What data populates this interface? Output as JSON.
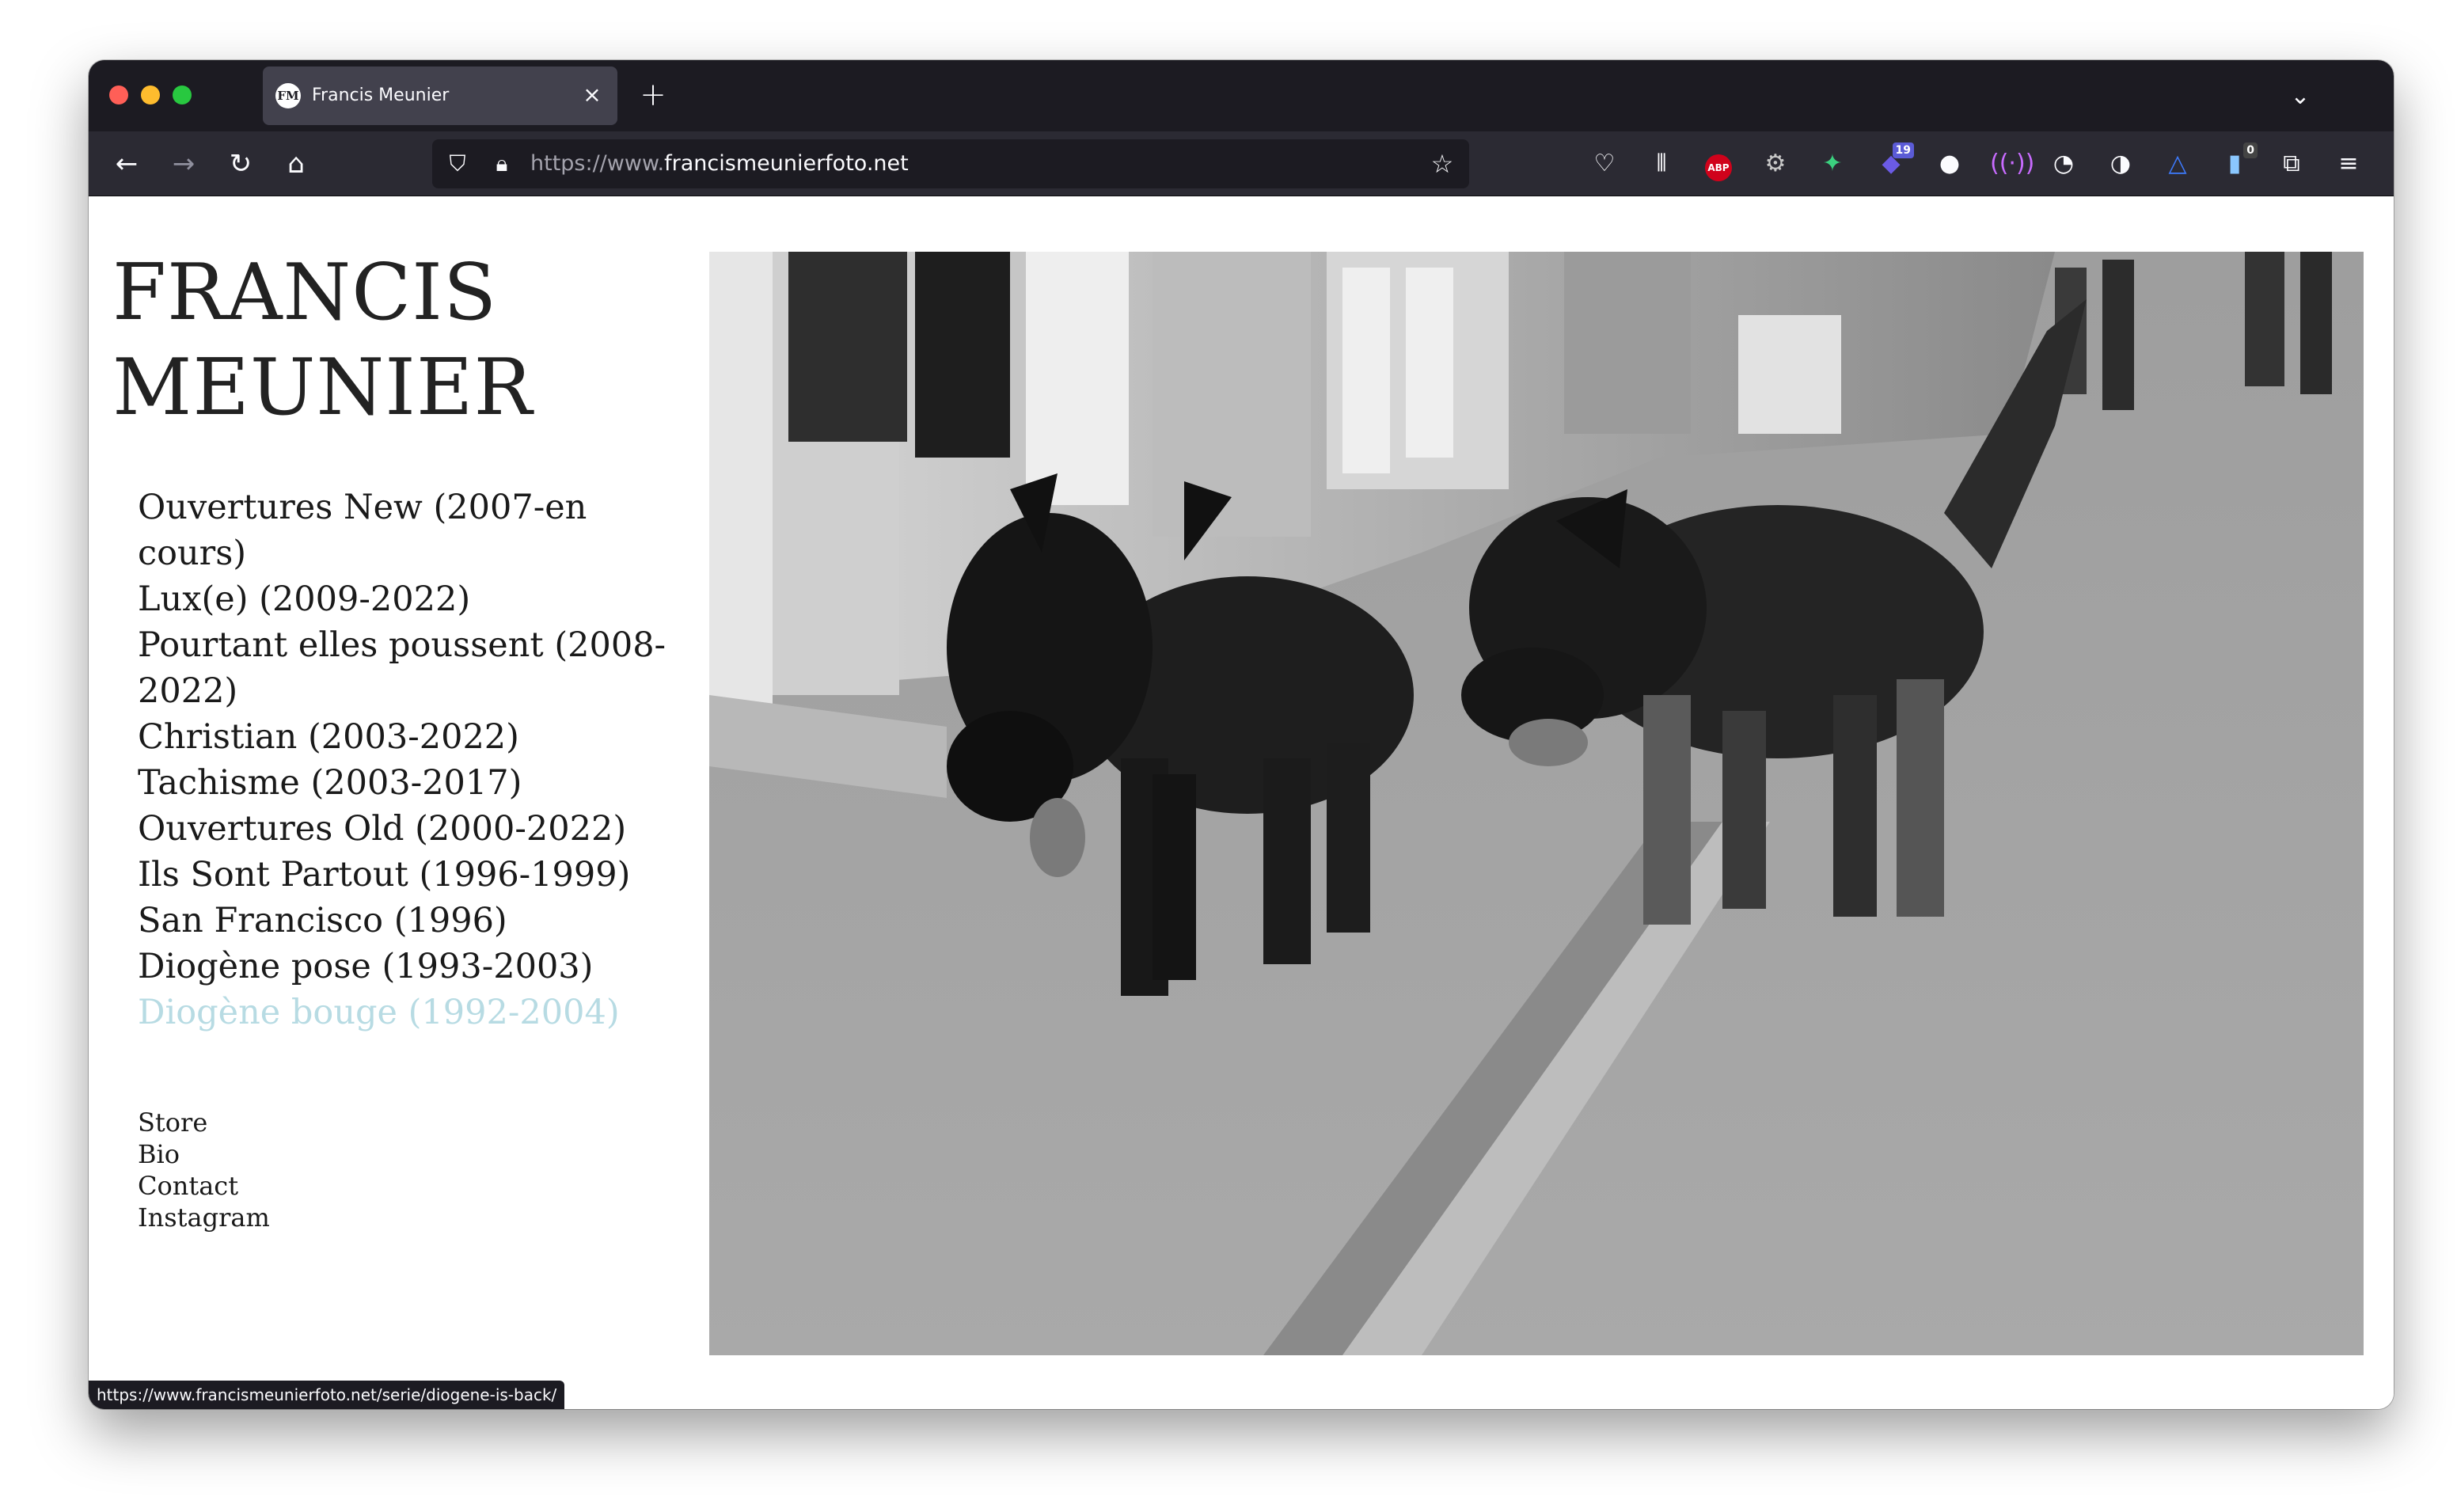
{
  "browser": {
    "tab_title": "Francis Meunier",
    "tab_favicon_text": "FM",
    "url_prefix": "https://www.",
    "url_domain": "francismeunierfoto.net",
    "status_url": "https://www.francismeunierfoto.net/serie/diogene-is-back/",
    "extension_badges": {
      "badge_a": "19",
      "badge_b": "0"
    },
    "abp_label": "ABP"
  },
  "site": {
    "title_line1": "FRANCIS",
    "title_line2": "MEUNIER",
    "series": [
      "Ouvertures New (2007-en cours)",
      "Lux(e) (2009-2022)",
      "Pourtant elles poussent (2008-2022)",
      "Christian (2003-2022)",
      "Tachisme (2003-2017)",
      "Ouvertures Old (2000-2022)",
      "Ils Sont Partout (1996-1999)",
      "San Francisco (1996)",
      "Diogène pose (1993-2003)",
      "Diogène bouge (1992-2004)"
    ],
    "active_series_color": "#b7dbe3",
    "pages": [
      "Store",
      "Bio",
      "Contact",
      "Instagram"
    ]
  }
}
